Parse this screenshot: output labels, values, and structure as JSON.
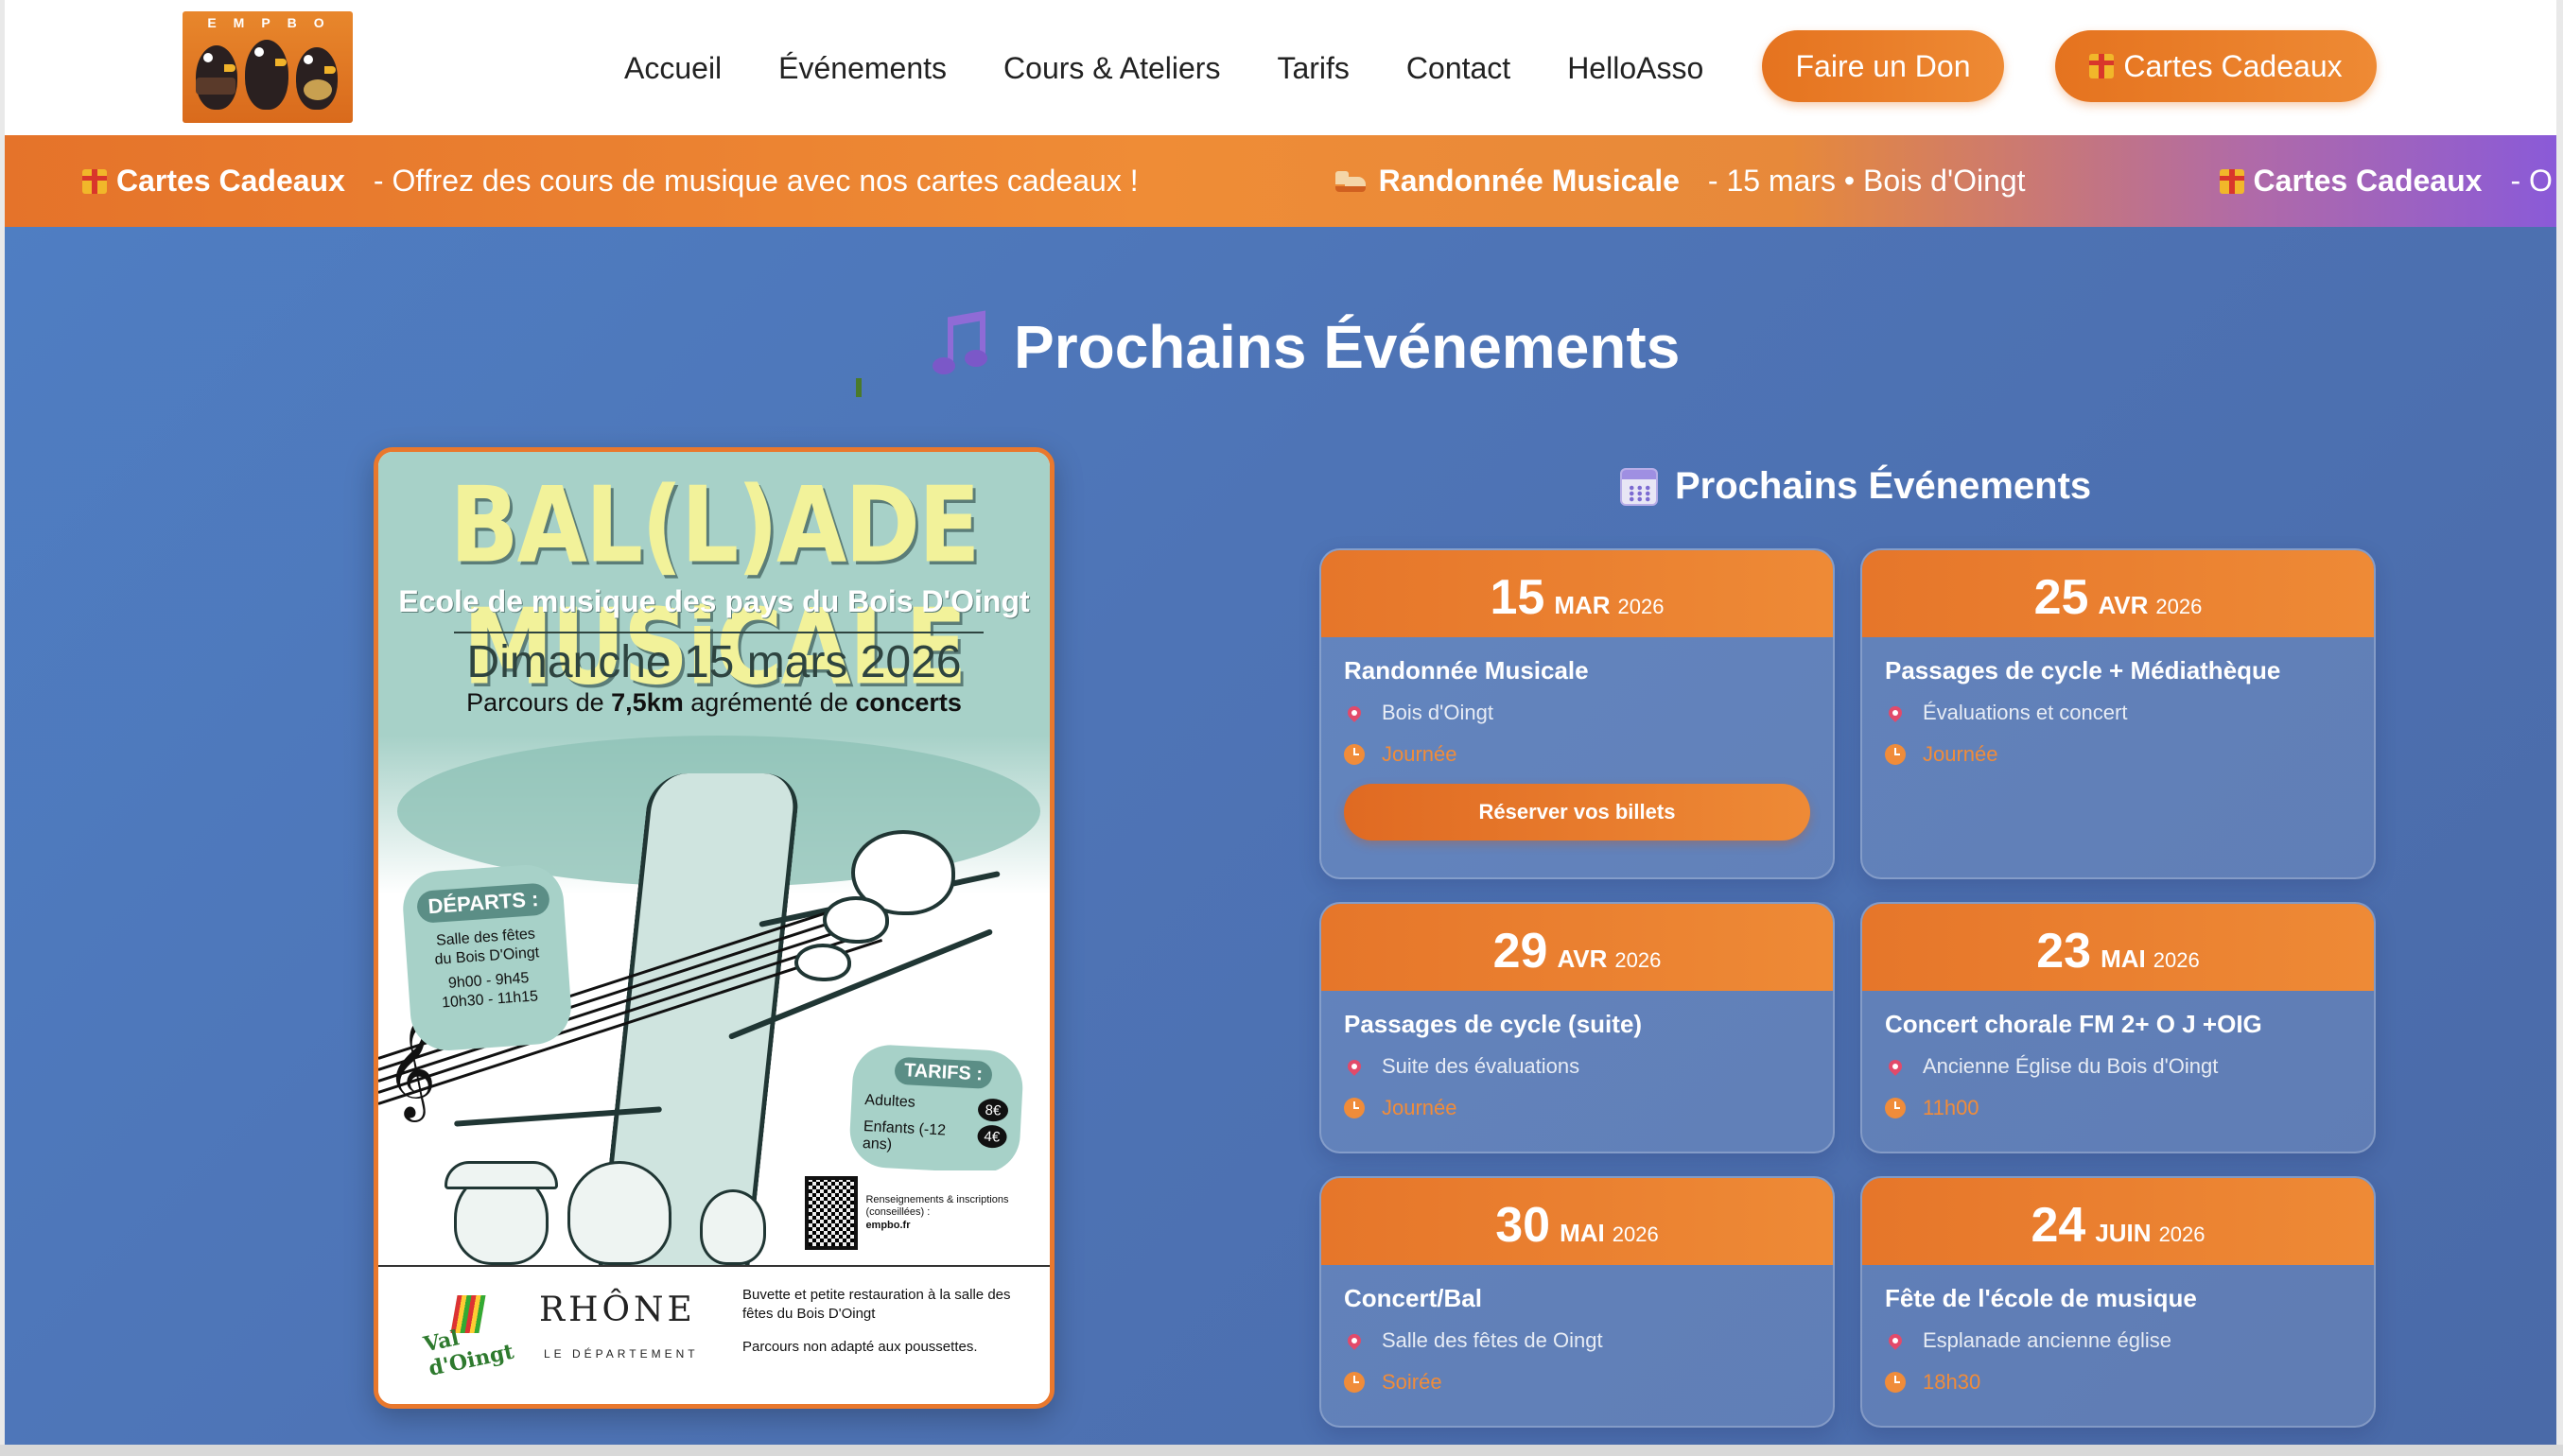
{
  "header": {
    "logo_text": "EMPBO",
    "nav": [
      "Accueil",
      "Événements",
      "Cours & Ateliers",
      "Tarifs",
      "Contact",
      "HelloAsso"
    ],
    "donate_label": "Faire un Don",
    "gift_label": "Cartes Cadeaux",
    "accent_color": "#ec7f2f"
  },
  "ticker": {
    "items": [
      {
        "icon": "gift-icon",
        "title": "Cartes Cadeaux",
        "desc": "- Offrez des cours de musique avec nos cartes cadeaux !"
      },
      {
        "icon": "shoe-icon",
        "title": "Randonnée Musicale",
        "desc": "- 15 mars • Bois d'Oingt"
      },
      {
        "icon": "gift-icon",
        "title": "Cartes Cadeaux",
        "desc": "- O"
      }
    ]
  },
  "section": {
    "title": "Prochains Événements"
  },
  "poster": {
    "title": "BAL(L)ADE MUSiCALE",
    "subtitle": "Ecole de musique des pays du Bois D'Oingt",
    "date": "Dimanche 15 mars 2026",
    "parcours_a": "Parcours de ",
    "parcours_b": "7,5km",
    "parcours_c": " agrémenté de ",
    "parcours_d": "concerts",
    "departs_title": "DÉPARTS :",
    "departs_lines": [
      "Salle des fêtes",
      "du Bois D'Oingt",
      "9h00 - 9h45",
      "10h30 - 11h15"
    ],
    "tarifs_title": "TARIFS :",
    "tarif_adultes_label": "Adultes",
    "tarif_adultes_price": "8€",
    "tarif_enfants_label": "Enfants (-12 ans)",
    "tarif_enfants_price": "4€",
    "qr_text": "Renseignements & inscriptions (conseillées) :",
    "qr_site": "empbo.fr",
    "val_text": "Val d'Oingt",
    "rhone": "RHÔNE",
    "rhone_sub": "LE DÉPARTEMENT",
    "info_1": "Buvette et petite restauration à la salle des fêtes du Bois D'Oingt",
    "info_2": "Parcours non adapté aux poussettes."
  },
  "events": {
    "heading": "Prochains Événements",
    "cards": [
      {
        "day": "15",
        "month": "MAR",
        "year": "2026",
        "title": "Randonnée Musicale",
        "location": "Bois d'Oingt",
        "time": "Journée",
        "button": "Réserver vos billets"
      },
      {
        "day": "25",
        "month": "AVR",
        "year": "2026",
        "title": "Passages de cycle + Médiathèque",
        "location": "Évaluations et concert",
        "time": "Journée"
      },
      {
        "day": "29",
        "month": "AVR",
        "year": "2026",
        "title": "Passages de cycle (suite)",
        "location": "Suite des évaluations",
        "time": "Journée"
      },
      {
        "day": "23",
        "month": "MAI",
        "year": "2026",
        "title": "Concert chorale FM 2+ O J +OIG",
        "location": "Ancienne Église du Bois d'Oingt",
        "time": "11h00"
      },
      {
        "day": "30",
        "month": "MAI",
        "year": "2026",
        "title": "Concert/Bal",
        "location": "Salle des fêtes de Oingt",
        "time": "Soirée"
      },
      {
        "day": "24",
        "month": "JUIN",
        "year": "2026",
        "title": "Fête de l'école de musique",
        "location": "Esplanade ancienne église",
        "time": "18h30"
      }
    ]
  }
}
